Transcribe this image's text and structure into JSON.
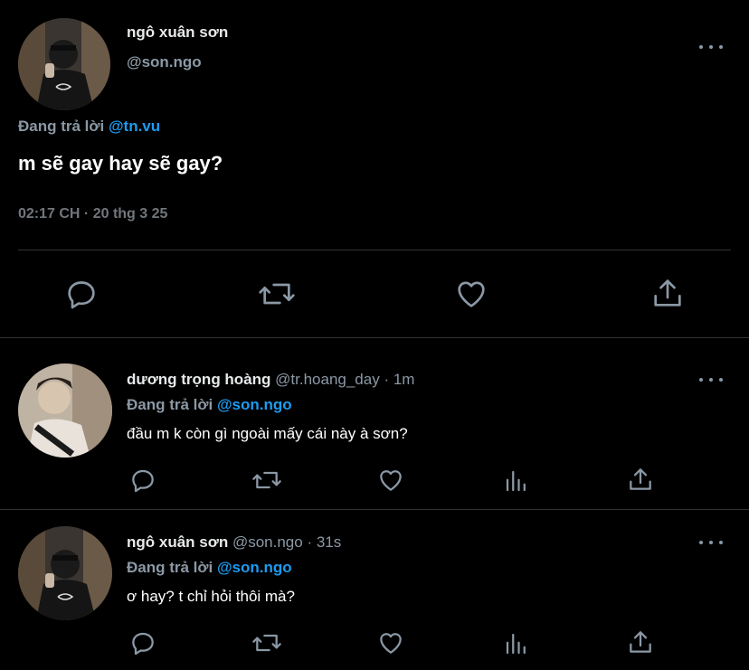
{
  "main_tweet": {
    "display_name": "ngô xuân sơn",
    "handle": "@son.ngo",
    "replying_prefix": "Đang trả lời",
    "replying_to": "@tn.vu",
    "text": "m sẽ gay hay sẽ gay?",
    "timestamp": "02:17 CH · 20 thg 3 25"
  },
  "replies": [
    {
      "display_name": "dương trọng hoàng",
      "handle": "@tr.hoang_day",
      "time": "· 1m",
      "replying_prefix": "Đang trả lời",
      "replying_to": "@son.ngo",
      "text": "đầu m k còn gì ngoài mấy cái này à sơn?"
    },
    {
      "display_name": "ngô xuân sơn",
      "handle": "@son.ngo",
      "time": "· 31s",
      "replying_prefix": "Đang trả lời",
      "replying_to": "@son.ngo",
      "text": "ơ hay? t chỉ hỏi thôi mà?"
    }
  ],
  "icons": [
    "reply-icon",
    "retweet-icon",
    "like-icon",
    "share-icon",
    "analytics-icon",
    "more-icon"
  ],
  "colors": {
    "background": "#000000",
    "text": "#e7e9ea",
    "secondary": "#8b98a5",
    "accent": "#1d9bf0",
    "divider": "#2f3336"
  }
}
